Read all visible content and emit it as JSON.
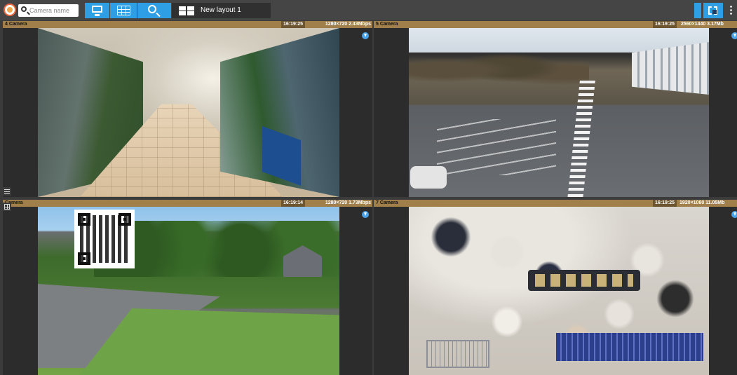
{
  "toolbar": {
    "search_placeholder": "Camera name",
    "layout_name": "New layout 1"
  },
  "cameras": [
    {
      "name": "4 Camera",
      "time": "16:19:25",
      "stats": "1280×720 2.43Mbps"
    },
    {
      "name": "5 Camera",
      "time": "16:19:25",
      "stats": "2560×1440 3.17Mb"
    },
    {
      "name": "Camera",
      "time": "16:19:14",
      "stats": "1280×720 1.73Mbps"
    },
    {
      "name": "7 Camera",
      "time": "16:19:25",
      "stats": "1920×1080 11.05Mb"
    }
  ],
  "colors": {
    "accent": "#2f9fe5",
    "tile_header": "#a07f4b",
    "toolbar_bg": "#454545"
  },
  "icons": [
    "app-logo-icon",
    "search-icon",
    "monitor-icon",
    "camera-grid-icon",
    "zoom-search-icon",
    "layout-grid-icon",
    "fullscreen-icon",
    "more-menu-icon",
    "download-icon",
    "list-icon",
    "tiles-icon"
  ]
}
